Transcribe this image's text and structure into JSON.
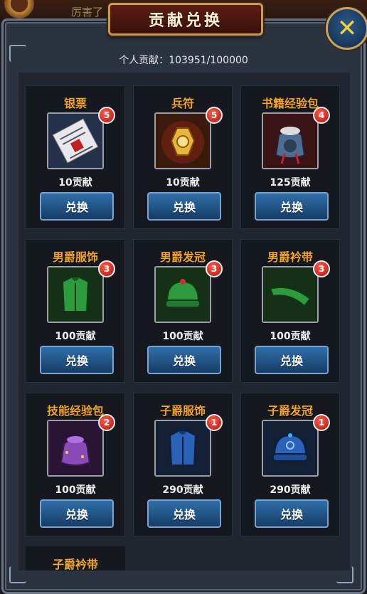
{
  "window": {
    "title": "贡献兑换",
    "close_icon": "close-x-icon",
    "behind_text": "厉害了"
  },
  "contribution": {
    "label": "个人贡献：",
    "value": "103951/100000"
  },
  "items": [
    {
      "name": "银票",
      "cost": "10贡献",
      "badge": "5",
      "icon": "banknote-icon",
      "button": "兑换"
    },
    {
      "name": "兵符",
      "cost": "10贡献",
      "badge": "5",
      "icon": "military-token-icon",
      "button": "兑换"
    },
    {
      "name": "书籍经验包",
      "cost": "125贡献",
      "badge": "4",
      "icon": "book-exp-bag-icon",
      "button": "兑换"
    },
    {
      "name": "男爵服饰",
      "cost": "100贡献",
      "badge": "3",
      "icon": "green-robe-icon",
      "button": "兑换"
    },
    {
      "name": "男爵发冠",
      "cost": "100贡献",
      "badge": "3",
      "icon": "green-cap-icon",
      "button": "兑换"
    },
    {
      "name": "男爵衿带",
      "cost": "100贡献",
      "badge": "3",
      "icon": "green-collar-icon",
      "button": "兑换"
    },
    {
      "name": "技能经验包",
      "cost": "100贡献",
      "badge": "2",
      "icon": "skill-exp-bag-icon",
      "button": "兑换"
    },
    {
      "name": "子爵服饰",
      "cost": "290贡献",
      "badge": "1",
      "icon": "blue-robe-icon",
      "button": "兑换"
    },
    {
      "name": "子爵发冠",
      "cost": "290贡献",
      "badge": "1",
      "icon": "blue-cap-icon",
      "button": "兑换"
    }
  ],
  "partial_item": {
    "name": "子爵衿带"
  }
}
